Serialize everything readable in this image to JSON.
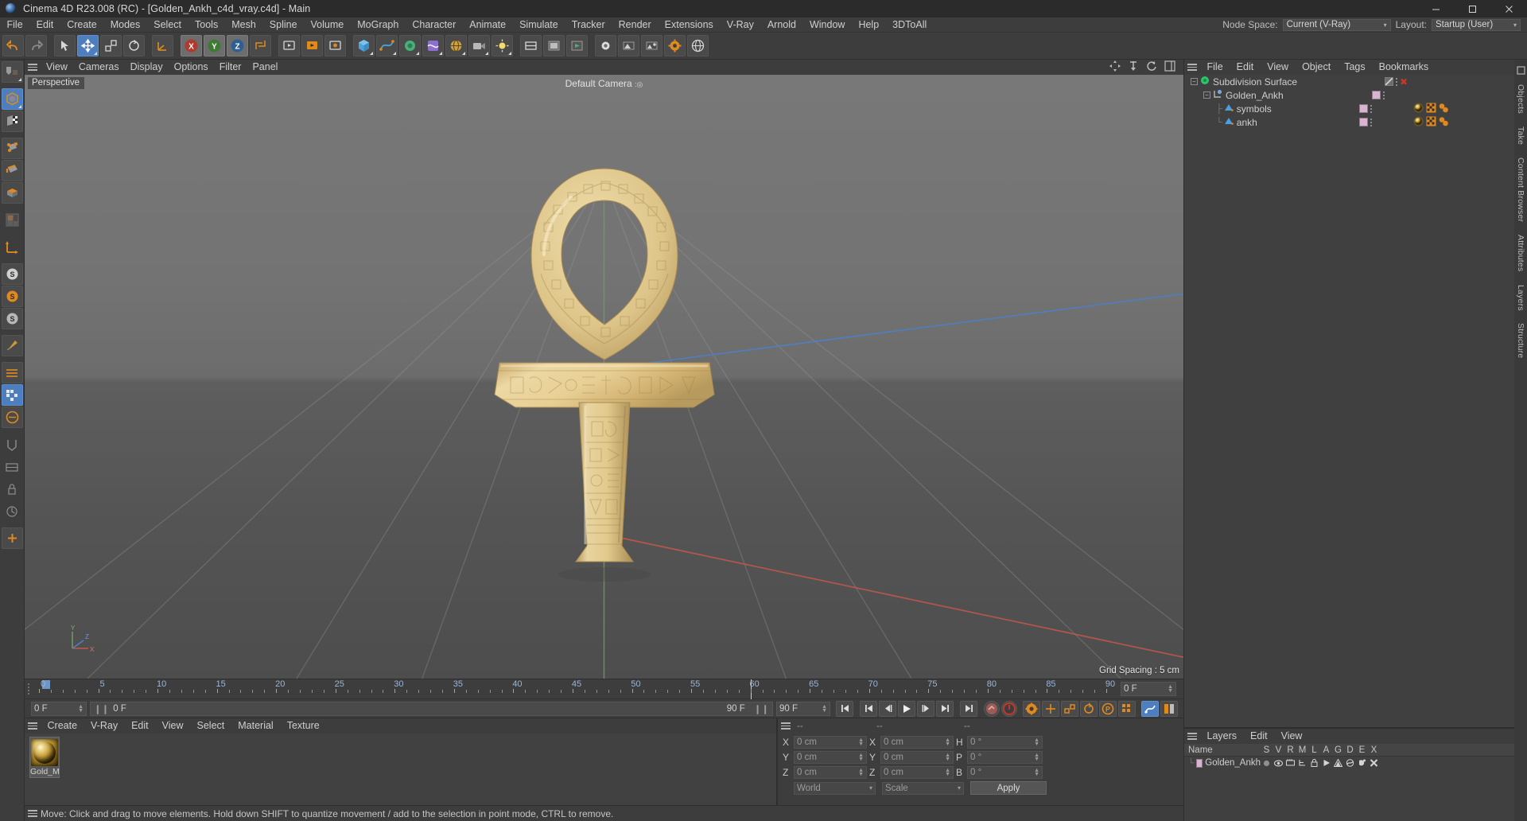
{
  "window": {
    "title": "Cinema 4D R23.008 (RC) - [Golden_Ankh_c4d_vray.c4d] - Main",
    "minimize": "—",
    "maximize": "❐",
    "close": "✕"
  },
  "menubar": {
    "items": [
      "File",
      "Edit",
      "Create",
      "Modes",
      "Select",
      "Tools",
      "Mesh",
      "Spline",
      "Volume",
      "MoGraph",
      "Character",
      "Animate",
      "Simulate",
      "Tracker",
      "Render",
      "Extensions",
      "V-Ray",
      "Arnold",
      "Window",
      "Help",
      "3DToAll"
    ],
    "node_space_label": "Node Space:",
    "node_space_value": "Current (V-Ray)",
    "layout_label": "Layout:",
    "layout_value": "Startup (User)"
  },
  "viewport": {
    "menu": [
      "View",
      "Cameras",
      "Display",
      "Options",
      "Filter",
      "Panel"
    ],
    "projection_label": "Perspective",
    "camera_label": "Default Camera",
    "grid_spacing": "Grid Spacing : 5 cm",
    "axis": {
      "x": "X",
      "y": "Y",
      "z": "Z"
    }
  },
  "timeline": {
    "ticks": [
      0,
      5,
      10,
      15,
      20,
      25,
      30,
      35,
      40,
      45,
      50,
      55,
      60,
      65,
      70,
      75,
      80,
      85,
      90
    ],
    "start_frame": "0 F",
    "current_frame": "0 F",
    "end_frame": "90 F",
    "preview_end": "90 F",
    "right_frame": "0 F"
  },
  "material_manager": {
    "menu": [
      "Create",
      "V-Ray",
      "Edit",
      "View",
      "Select",
      "Material",
      "Texture"
    ],
    "materials": [
      {
        "name": "Gold_MA"
      }
    ]
  },
  "coordinates": {
    "headers": [
      "--",
      "--",
      "--"
    ],
    "rows": [
      {
        "label1": "X",
        "value1": "0 cm",
        "label2": "X",
        "value2": "0 cm",
        "label3": "H",
        "value3": "0 °"
      },
      {
        "label1": "Y",
        "value1": "0 cm",
        "label2": "Y",
        "value2": "0 cm",
        "label3": "P",
        "value3": "0 °"
      },
      {
        "label1": "Z",
        "value1": "0 cm",
        "label2": "Z",
        "value2": "0 cm",
        "label3": "B",
        "value3": "0 °"
      }
    ],
    "system": "World",
    "mode": "Scale",
    "apply": "Apply"
  },
  "object_manager": {
    "menu": [
      "File",
      "Edit",
      "View",
      "Object",
      "Tags",
      "Bookmarks"
    ],
    "rows": [
      {
        "name": "Subdivision Surface",
        "depth": 0,
        "type": "generator"
      },
      {
        "name": "Golden_Ankh",
        "depth": 1,
        "type": "null"
      },
      {
        "name": "symbols",
        "depth": 2,
        "type": "polygon"
      },
      {
        "name": "ankh",
        "depth": 2,
        "type": "polygon"
      }
    ]
  },
  "layer_manager": {
    "menu": [
      "Layers",
      "Edit",
      "View"
    ],
    "columns": [
      "Name",
      "S",
      "V",
      "R",
      "M",
      "L",
      "A",
      "G",
      "D",
      "E",
      "X"
    ],
    "rows": [
      {
        "name": "Golden_Ankh"
      }
    ]
  },
  "right_tabs": [
    "Objects",
    "Take",
    "Content Browser",
    "Attributes",
    "Layers",
    "Structure"
  ],
  "statusbar": {
    "text": "Move: Click and drag to move elements. Hold down SHIFT to quantize movement / add to the selection in point mode, CTRL to remove."
  },
  "colors": {
    "accent_blue": "#4d7fbf",
    "orange": "#e08a1e",
    "red": "#c0392b",
    "gold": "#e8cf7d"
  }
}
